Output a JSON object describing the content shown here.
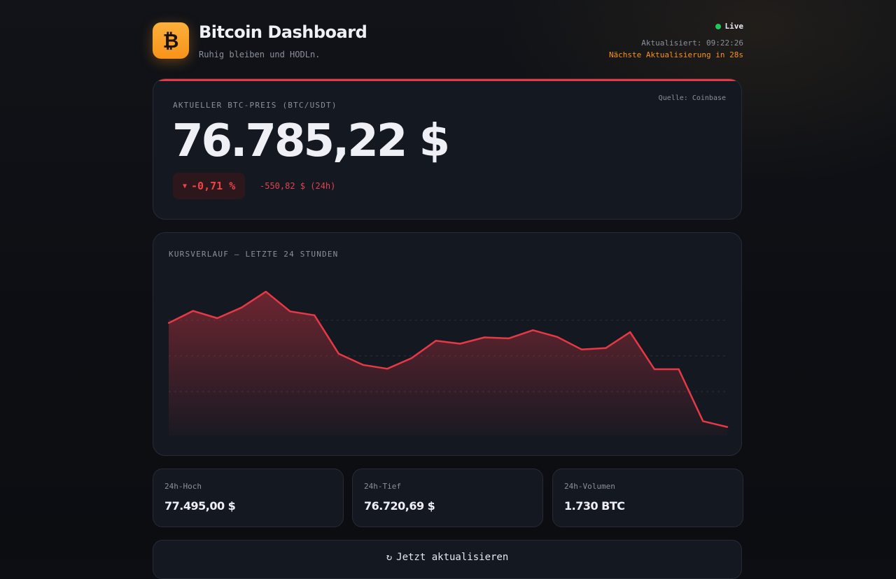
{
  "header": {
    "logo_glyph": "₿",
    "title": "Bitcoin Dashboard",
    "subtitle": "Ruhig bleiben und HODLn.",
    "live_label": "Live",
    "updated": "Aktualisiert: 09:22:26",
    "next_update": "Nächste Aktualisierung in 28s"
  },
  "price_card": {
    "source": "Quelle: Coinbase",
    "label": "AKTUELLER BTC-PREIS (BTC/USDT)",
    "price": "76.785,22 $",
    "change_arrow": "▼",
    "change_pct": "-0,71 %",
    "change_abs": "-550,82 $ (24h)"
  },
  "chart_card": {
    "title": "KURSVERLAUF — LETZTE 24 STUNDEN"
  },
  "chart_data": {
    "type": "area",
    "title": "KURSVERLAUF — LETZTE 24 STUNDEN",
    "x": [
      0,
      1,
      2,
      3,
      4,
      5,
      6,
      7,
      8,
      9,
      10,
      11,
      12,
      13,
      14,
      15,
      16,
      17,
      18,
      19,
      20,
      21,
      22,
      23
    ],
    "values": [
      77430,
      77455,
      77440,
      77462,
      77495,
      77454,
      77446,
      77366,
      77343,
      77335,
      77357,
      77393,
      77387,
      77400,
      77398,
      77415,
      77401,
      77375,
      77378,
      77411,
      77334,
      77334,
      77226,
      77214
    ],
    "ylim": [
      77196,
      77530
    ],
    "grid": true,
    "color": "#e63946"
  },
  "stats": [
    {
      "label": "24h-Hoch",
      "value": "77.495,00 $"
    },
    {
      "label": "24h-Tief",
      "value": "76.720,69 $"
    },
    {
      "label": "24h-Volumen",
      "value": "1.730 BTC"
    }
  ],
  "refresh": {
    "icon": "refresh-icon",
    "glyph": "↻",
    "label": "Jetzt aktualisieren"
  },
  "colors": {
    "accent": "#f7931a",
    "negative": "#e63946",
    "live": "#22c55e"
  }
}
